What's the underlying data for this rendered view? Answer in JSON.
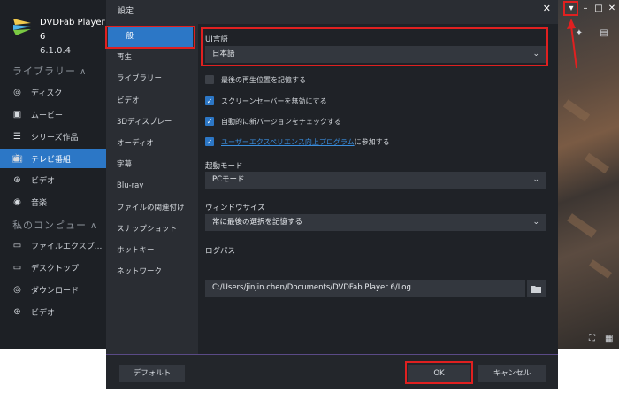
{
  "app": {
    "name": "DVDFab Player 6",
    "version": "6.1.0.4",
    "library_title": "ライブラリー",
    "library_items": [
      {
        "label": "ディスク",
        "icon": "disc-icon"
      },
      {
        "label": "ムービー",
        "icon": "movie-icon"
      },
      {
        "label": "シリーズ作品",
        "icon": "series-icon"
      },
      {
        "label": "テレビ番組",
        "icon": "tv-icon",
        "active": true
      },
      {
        "label": "ビデオ",
        "icon": "video-icon"
      },
      {
        "label": "音楽",
        "icon": "music-icon"
      }
    ],
    "computer_title": "私のコンピュー",
    "computer_items": [
      {
        "label": "ファイルエクスプ...",
        "icon": "file-explorer-icon"
      },
      {
        "label": "デスクトップ",
        "icon": "desktop-icon"
      },
      {
        "label": "ダウンロード",
        "icon": "download-icon"
      },
      {
        "label": "ビデオ",
        "icon": "video-icon"
      }
    ]
  },
  "dialog": {
    "title": "設定",
    "nav": [
      {
        "label": "一般",
        "active": true
      },
      {
        "label": "再生"
      },
      {
        "label": "ライブラリー"
      },
      {
        "label": "ビデオ"
      },
      {
        "label": "3Dディスプレー"
      },
      {
        "label": "オーディオ"
      },
      {
        "label": "字幕"
      },
      {
        "label": "Blu-ray"
      },
      {
        "label": "ファイルの関連付け"
      },
      {
        "label": "スナップショット"
      },
      {
        "label": "ホットキー"
      },
      {
        "label": "ネットワーク"
      }
    ],
    "ui_language_label": "UI言語",
    "ui_language_value": "日本語",
    "options": [
      {
        "label": "最後の再生位置を記憶する",
        "checked": false
      },
      {
        "label": "スクリーンセーバーを無効にする",
        "checked": true
      },
      {
        "label": "自動的に新バージョンをチェックする",
        "checked": true
      },
      {
        "label_link": "ユーザーエクスペリエンス向上プログラム",
        "label_suffix": "に参加する",
        "checked": true
      }
    ],
    "startup_mode_label": "起動モード",
    "startup_mode_value": "PCモード",
    "window_size_label": "ウィンドウサイズ",
    "window_size_value": "常に最後の選択を記憶する",
    "log_path_label": "ログパス",
    "log_path_value": "C:/Users/jinjin.chen/Documents/DVDFab Player 6/Log",
    "default_button": "デフォルト",
    "ok_button": "OK",
    "cancel_button": "キャンセル"
  },
  "colors": {
    "accent": "#2c77c6",
    "highlight_red": "#e02020",
    "link": "#3a8fe0"
  }
}
